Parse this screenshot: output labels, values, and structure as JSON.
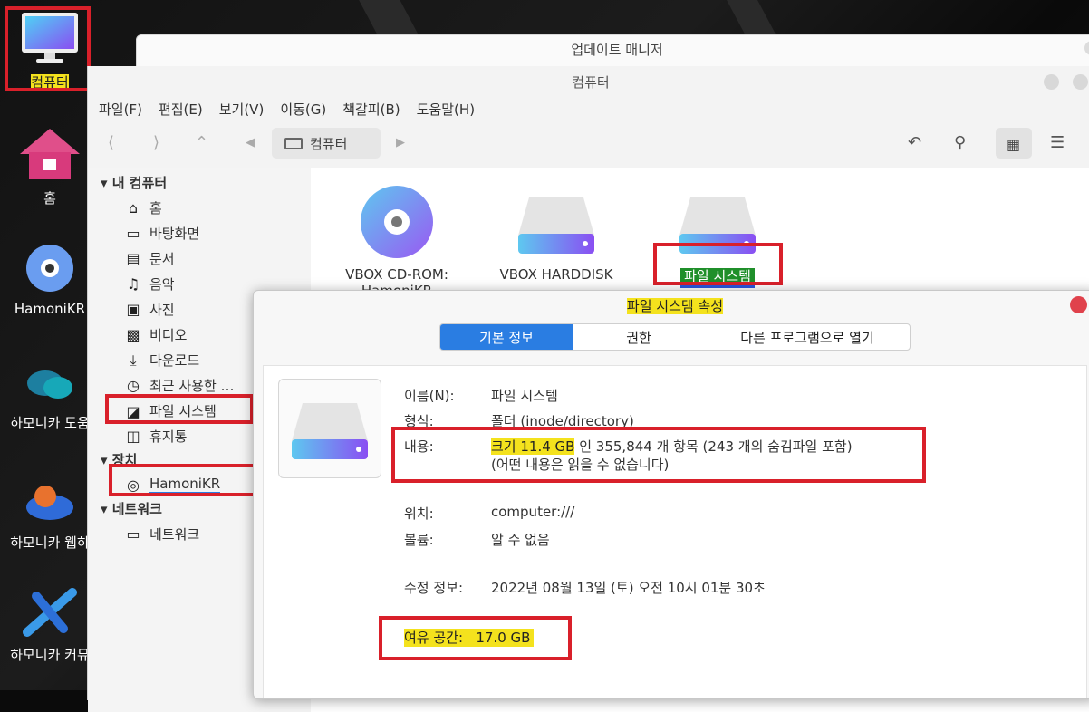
{
  "colors": {
    "highlight": "#f4e21d",
    "annotation": "#d9202a",
    "accent": "#2a7de2"
  },
  "desktop": {
    "icons": [
      {
        "label": "컴퓨터",
        "icon": "monitor-icon"
      },
      {
        "label": "홈",
        "icon": "home-icon"
      },
      {
        "label": "HamoniKR",
        "icon": "disc-icon"
      },
      {
        "label": "하모니카 도움",
        "icon": "help-icon"
      },
      {
        "label": "하모니카 웹하",
        "icon": "cloud-link-icon"
      },
      {
        "label": "하모니카 커뮤",
        "icon": "community-icon"
      }
    ]
  },
  "update_manager": {
    "title": "업데이트 매니저"
  },
  "file_manager": {
    "title": "컴퓨터",
    "menu": [
      "파일(F)",
      "편집(E)",
      "보기(V)",
      "이동(G)",
      "책갈피(B)",
      "도움말(H)"
    ],
    "path": "컴퓨터",
    "sidebar": {
      "my_computer": "내 컴퓨터",
      "items": [
        "홈",
        "바탕화면",
        "문서",
        "음악",
        "사진",
        "비디오",
        "다운로드",
        "최근 사용한 …",
        "파일 시스템",
        "휴지통"
      ],
      "devices": "장치",
      "device_items": [
        "HamoniKR"
      ],
      "network": "네트워크",
      "network_items": [
        "네트워크"
      ]
    },
    "items": [
      {
        "label": "VBOX CD-ROM:",
        "label2": "HamoniKR",
        "icon": "cdrom-icon"
      },
      {
        "label": "VBOX HARDDISK",
        "icon": "harddisk-icon"
      },
      {
        "label": "파일 시스템",
        "icon": "harddisk-icon"
      }
    ]
  },
  "properties": {
    "title": "파일 시스템 속성",
    "tabs": [
      "기본 정보",
      "권한",
      "다른 프로그램으로 열기"
    ],
    "name_label": "이름(N):",
    "name": "파일 시스템",
    "type_label": "형식:",
    "type": "폴더 (inode/directory)",
    "contents_label": "내용:",
    "contents_size": "크기 11.4 GB",
    "contents_rest": " 인 355,844 개 항목 (243 개의 숨김파일 포함)",
    "contents_note": "(어떤 내용은 읽을 수 없습니다)",
    "location_label": "위치:",
    "location": "computer:///",
    "volume_label": "볼륨:",
    "volume": "알 수 없음",
    "modified_label": "수정 정보:",
    "modified": "2022년 08월 13일 (토) 오전 10시 01분 30초",
    "free_label": "여유 공간:",
    "free": "17.0 GB"
  }
}
